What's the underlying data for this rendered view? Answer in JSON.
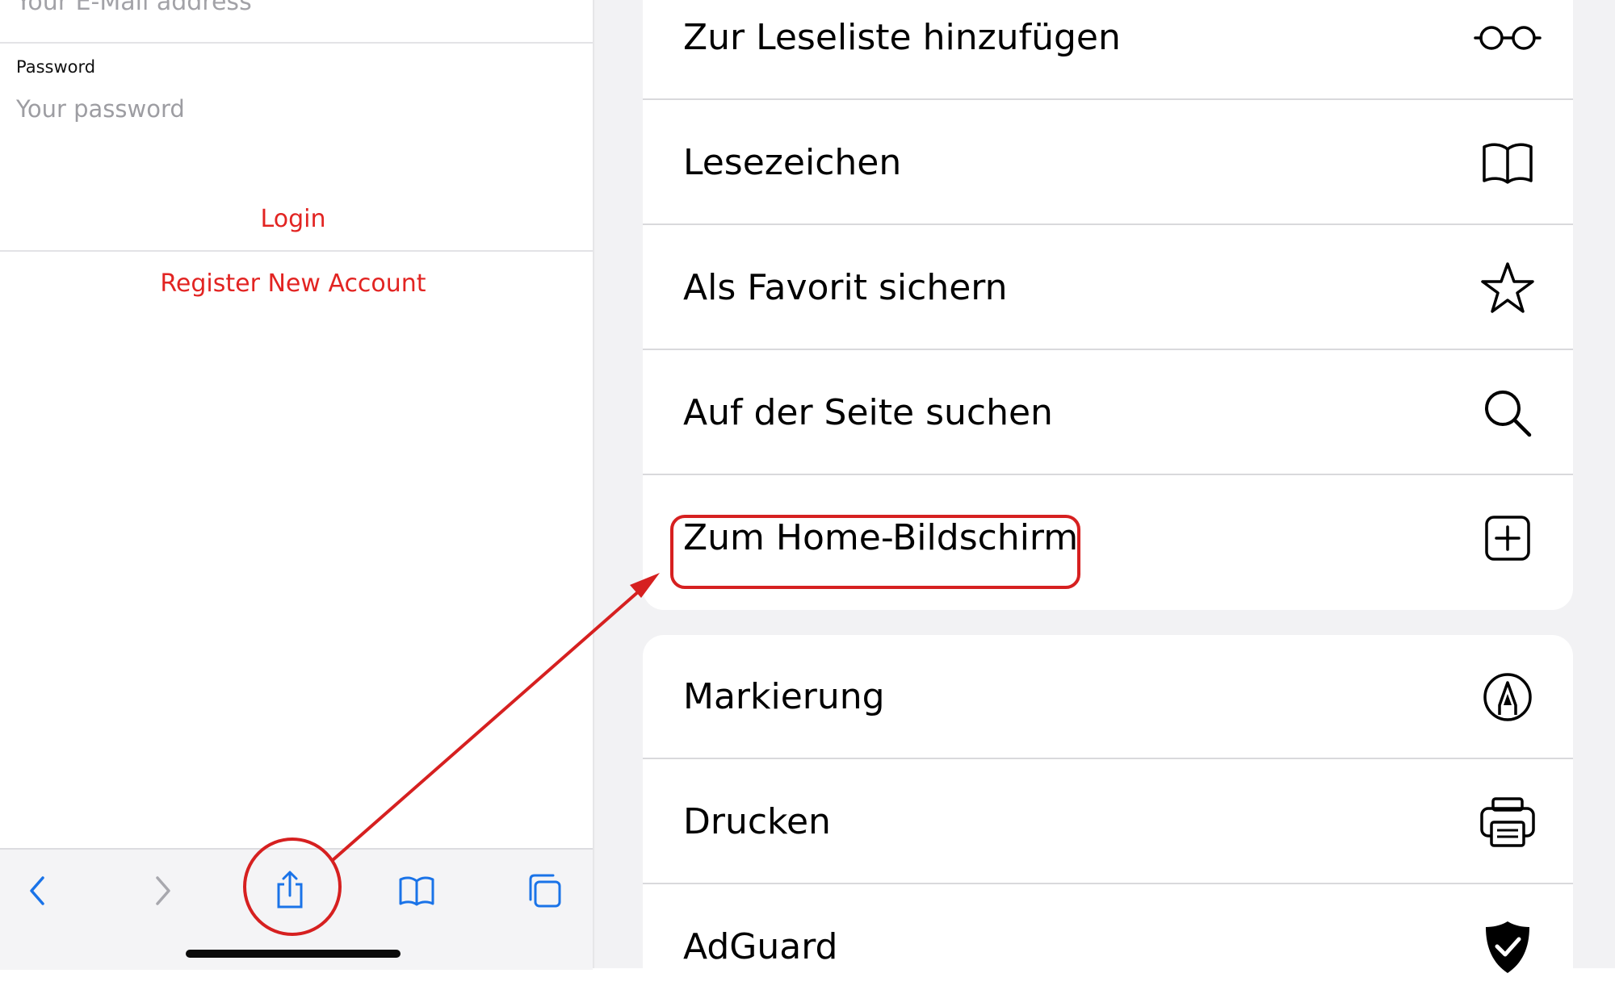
{
  "login_form": {
    "email_placeholder": "Your E-Mail address",
    "password_label": "Password",
    "password_placeholder": "Your password",
    "login_label": "Login",
    "register_label": "Register New Account"
  },
  "safari_toolbar": {
    "icons": [
      "chevron-left-icon",
      "chevron-right-icon",
      "share-icon",
      "book-icon",
      "tabs-icon"
    ],
    "accent_color": "#1a73e8"
  },
  "share_sheet": {
    "group1": [
      {
        "label": "Zur Leseliste hinzufügen",
        "icon": "glasses-icon"
      },
      {
        "label": "Lesezeichen",
        "icon": "book-icon"
      },
      {
        "label": "Als Favorit sichern",
        "icon": "star-icon"
      },
      {
        "label": "Auf der Seite suchen",
        "icon": "search-icon"
      },
      {
        "label": "Zum Home-Bildschirm",
        "icon": "plus-square-icon"
      }
    ],
    "group2": [
      {
        "label": "Markierung",
        "icon": "markup-icon"
      },
      {
        "label": "Drucken",
        "icon": "printer-icon"
      },
      {
        "label": "AdGuard",
        "icon": "shield-check-icon"
      }
    ]
  },
  "annotation": {
    "color": "#d62020",
    "highlighted_item": "Zum Home-Bildschirm"
  }
}
